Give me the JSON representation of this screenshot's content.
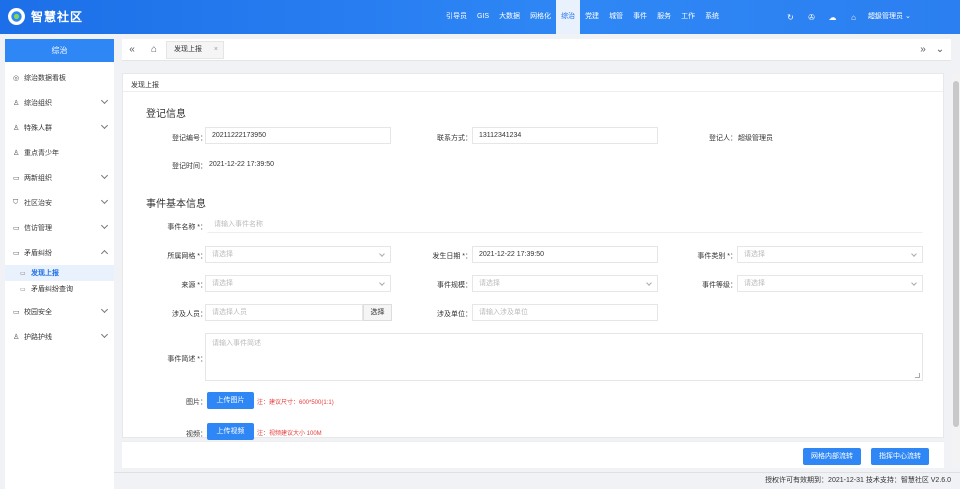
{
  "header": {
    "app_title": "智慧社区",
    "nav": [
      "引导员",
      "GIS",
      "大数据",
      "网格化",
      "综治",
      "党建",
      "城管",
      "事件",
      "服务",
      "工作",
      "系统"
    ],
    "nav_active_index": 4,
    "user": "超级管理员",
    "icons": [
      "refresh-icon",
      "notification-icon",
      "cloud-icon",
      "tag-icon",
      "fullscreen-icon"
    ],
    "accent_color": "#2f87f5"
  },
  "sidebar": {
    "title": "综治",
    "items": [
      {
        "label": "综治数据看板",
        "icon": "dashboard-icon",
        "chevron": false
      },
      {
        "label": "综治组织",
        "icon": "user-icon",
        "chevron": true
      },
      {
        "label": "特殊人群",
        "icon": "user-icon",
        "chevron": true
      },
      {
        "label": "重点青少年",
        "icon": "user-icon",
        "chevron": false
      },
      {
        "label": "两新组织",
        "icon": "doc-icon",
        "chevron": true
      },
      {
        "label": "社区治安",
        "icon": "shield-icon",
        "chevron": true
      },
      {
        "label": "信访管理",
        "icon": "doc-icon",
        "chevron": true
      },
      {
        "label": "矛盾纠纷",
        "icon": "doc-icon",
        "chevron": true,
        "expanded": true
      }
    ],
    "sub_items": [
      {
        "label": "发现上报",
        "active": true
      },
      {
        "label": "矛盾纠纷查询",
        "active": false
      }
    ],
    "items_after": [
      {
        "label": "校园安全",
        "icon": "doc-icon",
        "chevron": true
      },
      {
        "label": "护路护线",
        "icon": "user-icon",
        "chevron": true
      }
    ]
  },
  "tabs": {
    "active_tab": "发现上报"
  },
  "main": {
    "page_title": "发现上报",
    "reg_section": "登记信息",
    "reg": {
      "number_label": "登记编号：",
      "number_value": "20211222173950",
      "contact_label": "联系方式：",
      "contact_value": "13112341234",
      "registrant_label": "登记人：",
      "registrant_value": "超级管理员",
      "time_label": "登记时间：",
      "time_value": "2021-12-22 17:39:50"
    },
    "event_section": "事件基本信息",
    "event": {
      "name_label": "事件名称 *：",
      "name_placeholder": "请输入事件名称",
      "grid_label": "所属网格 *：",
      "grid_placeholder": "请选择",
      "date_label": "发生日期 *：",
      "date_value": "2021-12-22 17:39:50",
      "category_label": "事件类别 *：",
      "category_placeholder": "请选择",
      "source_label": "来源 *：",
      "source_placeholder": "请选择",
      "scale_label": "事件规模：",
      "scale_placeholder": "请选择",
      "level_label": "事件等级：",
      "level_placeholder": "请选择",
      "person_label": "涉及人员：",
      "person_placeholder": "请选择人员",
      "select_button": "选择",
      "unit_label": "涉及单位：",
      "unit_placeholder": "请输入涉及单位",
      "desc_label": "事件简述 *：",
      "desc_placeholder": "请输入事件简述",
      "image_label": "图片：",
      "image_button": "上传图片",
      "image_note": "注：建议尺寸：600*500(1:1)",
      "video_label": "视频：",
      "video_button": "上传视频",
      "video_note": "注：视频建议大小 100M"
    },
    "actions": {
      "grid_flow": "网格内部流转",
      "center_flow": "指挥中心流转"
    }
  },
  "status": {
    "text": "授权许可有效期到：2021-12-31 技术支持：智慧社区  V2.6.0"
  }
}
